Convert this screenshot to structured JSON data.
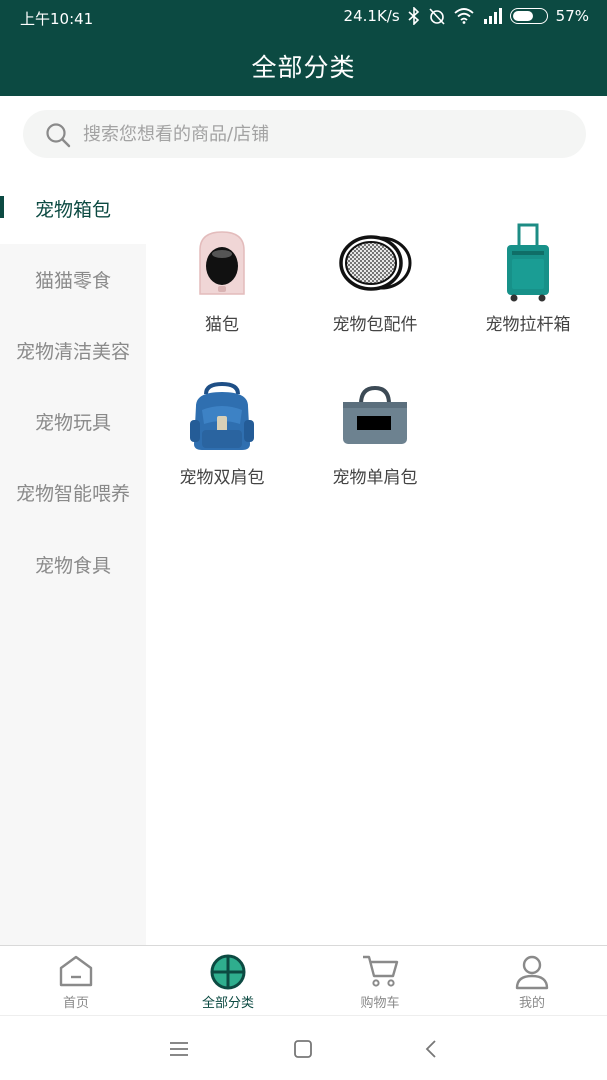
{
  "status_bar": {
    "time": "上午10:41",
    "speed": "24.1K/s",
    "battery": "57%",
    "icons": [
      "bluetooth-icon",
      "alarm-off-icon",
      "wifi-icon",
      "signal-icon",
      "battery-icon"
    ]
  },
  "header": {
    "title": "全部分类"
  },
  "search": {
    "placeholder": "搜索您想看的商品/店铺"
  },
  "sidebar": {
    "items": [
      {
        "label": "宠物箱包",
        "active": true
      },
      {
        "label": "猫猫零食"
      },
      {
        "label": "宠物清洁美容"
      },
      {
        "label": "宠物玩具"
      },
      {
        "label": "宠物智能喂养"
      },
      {
        "label": "宠物食具"
      }
    ]
  },
  "products": [
    {
      "label": "猫包",
      "icon": "cat-carrier-icon"
    },
    {
      "label": "宠物包配件",
      "icon": "mesh-window-icon"
    },
    {
      "label": "宠物拉杆箱",
      "icon": "rolling-suitcase-icon"
    },
    {
      "label": "宠物双肩包",
      "icon": "backpack-icon"
    },
    {
      "label": "宠物单肩包",
      "icon": "shoulder-bag-icon"
    }
  ],
  "bottom_nav": {
    "items": [
      {
        "label": "首页",
        "icon": "home-icon"
      },
      {
        "label": "全部分类",
        "icon": "category-icon",
        "active": true
      },
      {
        "label": "购物车",
        "icon": "cart-icon"
      },
      {
        "label": "我的",
        "icon": "profile-icon"
      }
    ]
  },
  "colors": {
    "primary": "#0c4a42",
    "sidebar_bg": "#f7f7f7",
    "text_muted": "#8a8a8a"
  }
}
